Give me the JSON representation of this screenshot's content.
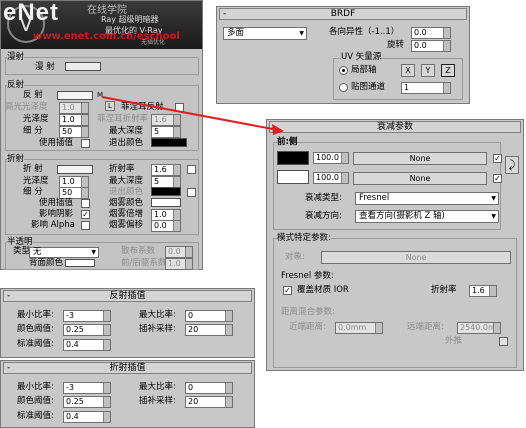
{
  "logo": {
    "brand": "eNet",
    "sub": "Ray 超级明暗器",
    "sub2": "最优化的 V-Ray",
    "sub3": "无插优化",
    "url": "www.enet.com.cn/eschool",
    "brand_cn": "在线学院"
  },
  "vray": {
    "diffuse_title": "漫射",
    "diffuse_label": "漫 射",
    "refl_title": "反射",
    "refl_label": "反 射",
    "refl_m": "M",
    "hilight_gloss": "高光光泽度",
    "hilight_val": "1.0",
    "l_btn": "L",
    "fresnel_label": "菲涅耳反射",
    "gloss_label": "光泽度",
    "gloss_val": "1.0",
    "fresnel_ior_label": "菲涅耳折射率",
    "fresnel_ior_val": "1.6",
    "subdiv_label": "细 分",
    "subdiv_val": "50",
    "max_depth_label": "最大深度",
    "max_depth_val": "5",
    "use_interp_label": "使用插值",
    "exit_color_label": "退出颜色",
    "refr_title": "折射",
    "refr_label": "折 射",
    "ior_label": "折射率",
    "ior_val": "1.6",
    "refr_gloss_label": "光泽度",
    "refr_gloss_val": "1.0",
    "refr_max_depth_label": "最大深度",
    "refr_max_depth_val": "5",
    "refr_subdiv_label": "细 分",
    "refr_subdiv_val": "50",
    "refr_exit_label": "退出颜色",
    "refr_use_interp": "使用插值",
    "fog_color_label": "烟雾颜色",
    "affect_shadow": "影响阴影",
    "fog_mult": "烟雾倍增",
    "fog_mult_val": "1.0",
    "affect_alpha": "影响 Alpha",
    "fog_bias": "烟雾偏移",
    "fog_bias_val": "0.0",
    "translucent_title": "半透明",
    "type_label": "类型",
    "type_val": "无",
    "scatter_label": "散布系数",
    "scatter_val": "0.0",
    "back_color_label": "背面颜色",
    "fb_label": "前/后驱系数",
    "fb_val": "1.0"
  },
  "brdf": {
    "title": "BRDF",
    "type": "多面",
    "aniso_label": "各向异性（-1..1）",
    "aniso_val": "0.0",
    "rotate_label": "旋转",
    "rotate_val": "0.0",
    "uv_title": "UV 矢量源",
    "local_axis": "局部轴",
    "x": "X",
    "y": "Y",
    "z": "Z",
    "map_channel": "贴图通道",
    "map_channel_val": "1"
  },
  "falloff": {
    "title": "衰减参数",
    "section": "前:侧",
    "v1": "100.0",
    "none1": "None",
    "v2": "100.0",
    "none2": "None",
    "type_label": "衰减类型:",
    "type_val": "Fresnel",
    "dir_label": "衰减方向:",
    "dir_val": "查看方向(摄影机 Z 轴)",
    "mode_title": "模式特定参数:",
    "object_label": "对象:",
    "object_val": "None",
    "fresnel_title": "Fresnel 参数:",
    "override_label": "覆盖材质 IOR",
    "ior_label": "折射率",
    "ior_val": "1.6",
    "dist_title": "距离混合参数:",
    "near_label": "近端距离:",
    "near_val": "0.0mm",
    "far_label": "远端距离:",
    "far_val": "2540.0m",
    "extrap_label": "外推"
  },
  "refl_interp": {
    "title": "反射插值",
    "min_rate": "最小比率:",
    "min_rate_val": "-3",
    "max_rate": "最大比率:",
    "max_rate_val": "0",
    "clr_thresh": "颜色阈值:",
    "clr_thresh_val": "0.25",
    "interp_samples": "插补采样:",
    "interp_samples_val": "20",
    "nrm_thresh": "标准阈值:",
    "nrm_thresh_val": "0.4"
  },
  "refr_interp": {
    "title": "折射插值",
    "min_rate": "最小比率:",
    "min_rate_val": "-3",
    "max_rate": "最大比率:",
    "max_rate_val": "0",
    "clr_thresh": "颜色阈值:",
    "clr_thresh_val": "0.25",
    "interp_samples": "插补采样:",
    "interp_samples_val": "20",
    "nrm_thresh": "标准阈值:",
    "nrm_thresh_val": "0.4"
  },
  "colors": {
    "arrow": "#e02020",
    "panel": "#c8c8c8"
  }
}
